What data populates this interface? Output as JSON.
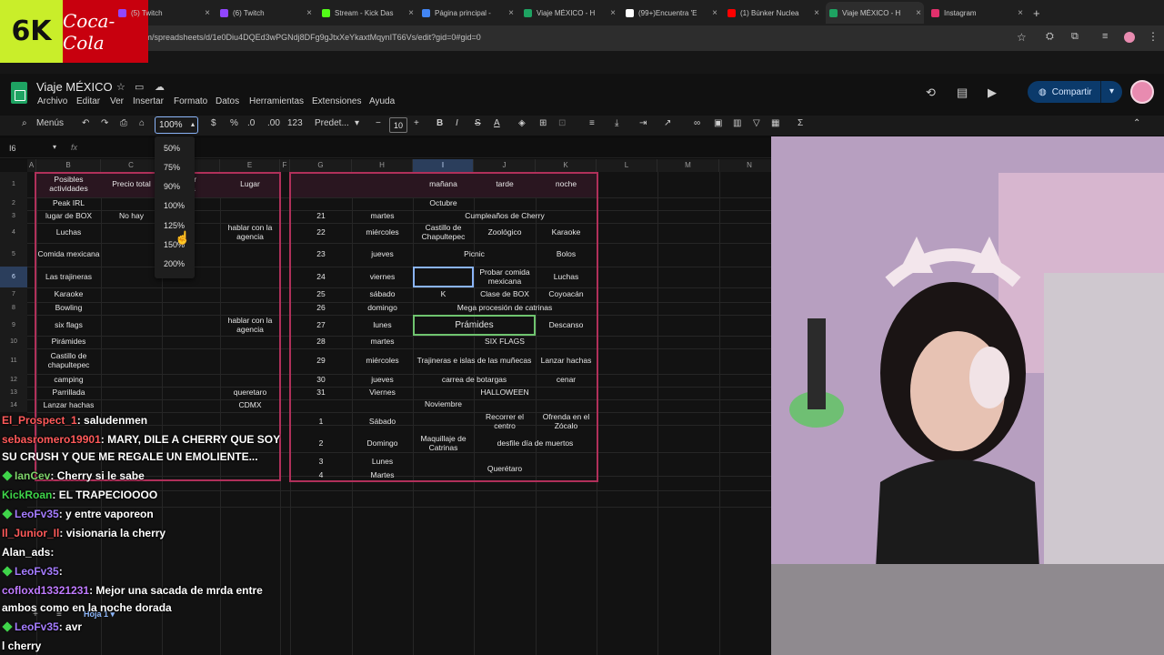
{
  "browser": {
    "tabs": [
      {
        "title": "(5) Twitch",
        "color": "#9146ff"
      },
      {
        "title": "(6) Twitch",
        "color": "#9146ff"
      },
      {
        "title": "Stream - Kick Das",
        "color": "#53fc18"
      },
      {
        "title": "Página principal -",
        "color": "#4285f4"
      },
      {
        "title": "Viaje MÉXICO - H",
        "color": "#1ea362"
      },
      {
        "title": "(99+)Encuentra 'E",
        "color": "#ffffff"
      },
      {
        "title": "(1) Búnker Nuclea",
        "color": "#ff0000"
      },
      {
        "title": "Viaje MÉXICO - H",
        "color": "#1ea362"
      },
      {
        "title": "Instagram",
        "color": "#e1306c"
      }
    ],
    "url": "com/spreadsheets/d/1e0Diu4DQEd3wPGNdj8DFg9gJtxXeYkaxtMqynIT66Vs/edit?gid=0#gid=0"
  },
  "overlay": {
    "logo_left": "6K",
    "logo_right": "Coca-Cola"
  },
  "sheet": {
    "title": "Viaje MÉXICO",
    "menu": [
      "Archivo",
      "Editar",
      "Ver",
      "Insertar",
      "Formato",
      "Datos",
      "Herramientas",
      "Extensiones",
      "Ayuda"
    ],
    "share_label": "Compartir",
    "search_label": "Menús",
    "zoom_value": "100%",
    "font_name": "Predet...",
    "font_size": "10",
    "cell_ref": "I6",
    "zoom_options": [
      "50%",
      "75%",
      "90%",
      "100%",
      "125%",
      "150%",
      "200%"
    ],
    "sheet_tab": "Hoja 1",
    "columns": [
      "A",
      "B",
      "C",
      "D",
      "E",
      "F",
      "G",
      "H",
      "I",
      "J",
      "K",
      "L",
      "M",
      "N"
    ],
    "left_table": {
      "headers": [
        "Posibles actividades",
        "Precio total",
        "Precio por persona",
        "Lugar"
      ],
      "header_visible_c": "Precio total",
      "header_visible_d": "por\nna",
      "rows": [
        {
          "b": "Peak IRL",
          "c": "",
          "e": ""
        },
        {
          "b": "lugar de BOX",
          "c": "No hay",
          "e": ""
        },
        {
          "b": "Luchas",
          "c": "",
          "e": "hablar con la agencia"
        },
        {
          "b": "Comida mexicana",
          "c": "",
          "e": ""
        },
        {
          "b": "Las trajineras",
          "c": "",
          "e": ""
        },
        {
          "b": "Karaoke",
          "c": "",
          "e": ""
        },
        {
          "b": "Bowling",
          "c": "",
          "e": ""
        },
        {
          "b": "six flags",
          "c": "",
          "e": "hablar con la agencia"
        },
        {
          "b": "Pirámides",
          "c": "",
          "e": ""
        },
        {
          "b": "Castillo de chapultepec",
          "c": "",
          "e": ""
        },
        {
          "b": "camping",
          "c": "",
          "e": ""
        },
        {
          "b": "Parrillada",
          "c": "",
          "e": "queretaro"
        },
        {
          "b": "Lanzar hachas",
          "c": "",
          "e": "CDMX"
        }
      ]
    },
    "right_table": {
      "headers": [
        "mañana",
        "tarde",
        "noche"
      ],
      "month1": "Octubre",
      "month2": "Noviembre",
      "rows": [
        {
          "n": "21",
          "d": "martes",
          "span": "Cumpleaños de Cherry"
        },
        {
          "n": "22",
          "d": "miércoles",
          "i": "Castillo de Chapultepec",
          "j": "Zoológico",
          "k": "Karaoke"
        },
        {
          "n": "23",
          "d": "jueves",
          "ij": "Picnic",
          "k": "Bolos"
        },
        {
          "n": "24",
          "d": "viernes",
          "i": "",
          "j": "Probar comida mexicana",
          "k": "Luchas"
        },
        {
          "n": "25",
          "d": "sábado",
          "i": "K",
          "j": "Clase de BOX",
          "k": "Coyoacán"
        },
        {
          "n": "26",
          "d": "domingo",
          "span": "Mega procesión de catrinas"
        },
        {
          "n": "27",
          "d": "lunes",
          "ij": "Prámides",
          "k": "Descanso"
        },
        {
          "n": "28",
          "d": "martes",
          "span": "SIX FLAGS"
        },
        {
          "n": "29",
          "d": "miércoles",
          "ij": "Trajineras e islas de las muñecas",
          "k": "Lanzar hachas"
        },
        {
          "n": "30",
          "d": "jueves",
          "ij": "carrea de botargas",
          "k": "cenar"
        },
        {
          "n": "31",
          "d": "Viernes",
          "span": "HALLOWEEN"
        },
        {
          "n": "1",
          "d": "Sábado",
          "i": "",
          "j": "Recorrer el centro",
          "k": "Ofrenda en el Zócalo"
        },
        {
          "n": "2",
          "d": "Domingo",
          "i": "Maquillaje de Catrinas",
          "jk": "desfile día de muertos"
        },
        {
          "n": "3",
          "d": "Lunes",
          "ij": "Querétaro"
        },
        {
          "n": "4",
          "d": "Martes"
        }
      ]
    },
    "row_numbers": [
      "1",
      "2",
      "3",
      "4",
      "5",
      "6",
      "7",
      "8",
      "9",
      "10",
      "11",
      "12",
      "13",
      "14"
    ]
  },
  "chat": [
    {
      "user": "El_Prospect_1",
      "msg": ": saludenmen",
      "color": "#ff5a5a"
    },
    {
      "user": "sebasromero19901",
      "msg": ": MARY, DILE A CHERRY QUE SOY",
      "color": "#ff5a5a"
    },
    {
      "user": "",
      "msg": "SU CRUSH Y QUE ME REGALE UN EMOLIENTE...",
      "color": "#ffffff"
    },
    {
      "user": "IanCev",
      "msg": ": Cherry si le sabe",
      "color": "#7fd36b"
    },
    {
      "user": "KickRoan",
      "msg": ": EL TRAPECIOOOO",
      "color": "#3fd54a"
    },
    {
      "user": "LeoFv35",
      "msg": ": y entre vaporeon",
      "color": "#a57cff"
    },
    {
      "user": "Il_Junior_Il",
      "msg": ": visionaria la cherry",
      "color": "#ff5a5a"
    },
    {
      "user": "Alan_ads",
      "msg": ":",
      "color": "#ffffff"
    },
    {
      "user": "LeoFv35",
      "msg": ":",
      "color": "#a57cff"
    },
    {
      "user": "cofloxd13321231",
      "msg": ": Mejor una sacada de mrda entre",
      "color": "#c07bff"
    },
    {
      "user": "",
      "msg": "ambos como en la noche dorada",
      "color": "#ffffff"
    },
    {
      "user": "LeoFv35",
      "msg": ": avr",
      "color": "#a57cff"
    },
    {
      "user": "",
      "msg": "l cherry",
      "color": "#ffffff"
    }
  ]
}
